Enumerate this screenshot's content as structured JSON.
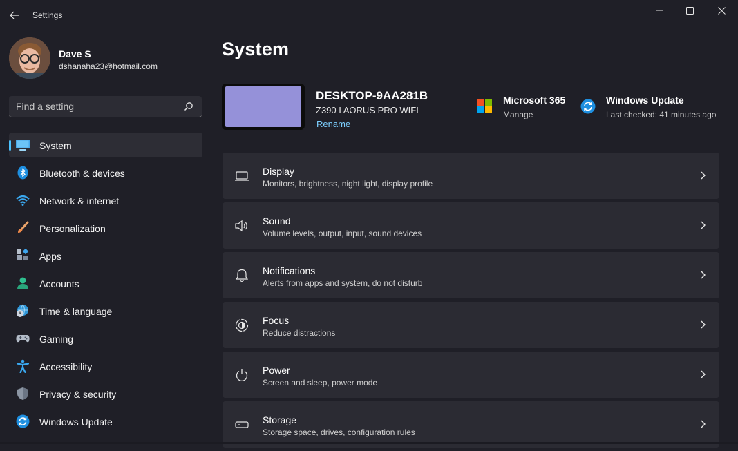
{
  "window": {
    "title": "Settings"
  },
  "user": {
    "name": "Dave S",
    "email": "dshanaha23@hotmail.com"
  },
  "search": {
    "placeholder": "Find a setting"
  },
  "sidebar": {
    "items": [
      {
        "label": "System",
        "icon": "display-icon",
        "active": true
      },
      {
        "label": "Bluetooth & devices",
        "icon": "bluetooth-icon"
      },
      {
        "label": "Network & internet",
        "icon": "wifi-icon"
      },
      {
        "label": "Personalization",
        "icon": "brush-icon"
      },
      {
        "label": "Apps",
        "icon": "apps-icon"
      },
      {
        "label": "Accounts",
        "icon": "person-icon"
      },
      {
        "label": "Time & language",
        "icon": "globe-clock-icon"
      },
      {
        "label": "Gaming",
        "icon": "gamepad-icon"
      },
      {
        "label": "Accessibility",
        "icon": "accessibility-icon"
      },
      {
        "label": "Privacy & security",
        "icon": "shield-icon"
      },
      {
        "label": "Windows Update",
        "icon": "update-icon"
      }
    ]
  },
  "main": {
    "title": "System",
    "device": {
      "name": "DESKTOP-9AA281B",
      "model": "Z390 I AORUS PRO WIFI",
      "rename_label": "Rename"
    },
    "quick_links": [
      {
        "title": "Microsoft 365",
        "subtitle": "Manage",
        "icon": "microsoft-logo-icon"
      },
      {
        "title": "Windows Update",
        "subtitle": "Last checked: 41 minutes ago",
        "icon": "update-icon"
      }
    ],
    "cards": [
      {
        "title": "Display",
        "subtitle": "Monitors, brightness, night light, display profile",
        "icon": "monitor-icon"
      },
      {
        "title": "Sound",
        "subtitle": "Volume levels, output, input, sound devices",
        "icon": "speaker-icon"
      },
      {
        "title": "Notifications",
        "subtitle": "Alerts from apps and system, do not disturb",
        "icon": "bell-icon"
      },
      {
        "title": "Focus",
        "subtitle": "Reduce distractions",
        "icon": "focus-icon"
      },
      {
        "title": "Power",
        "subtitle": "Screen and sleep, power mode",
        "icon": "power-icon"
      },
      {
        "title": "Storage",
        "subtitle": "Storage space, drives, configuration rules",
        "icon": "storage-icon"
      }
    ]
  },
  "colors": {
    "accent": "#4cc2ff",
    "link": "#7ccfff",
    "background": "#1f1f27",
    "card": "#2b2b33"
  }
}
